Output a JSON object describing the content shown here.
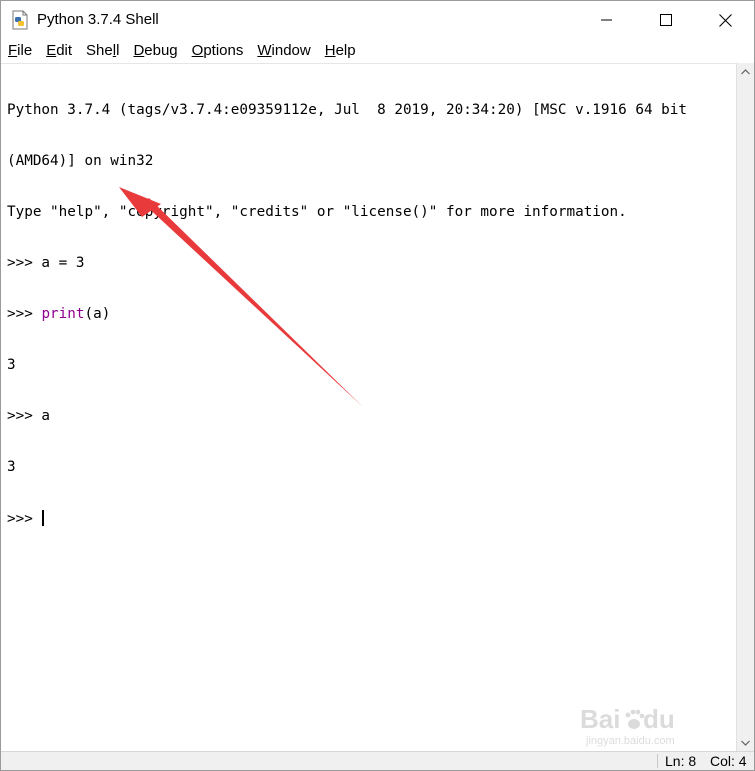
{
  "window": {
    "title": "Python 3.7.4 Shell",
    "controls": {
      "minimize_icon": "minimize-icon",
      "maximize_icon": "maximize-icon",
      "close_icon": "close-icon"
    }
  },
  "menu": {
    "items": [
      {
        "label": "File",
        "mnemonic": "F"
      },
      {
        "label": "Edit",
        "mnemonic": "E"
      },
      {
        "label": "Shell",
        "mnemonic": "l"
      },
      {
        "label": "Debug",
        "mnemonic": "D"
      },
      {
        "label": "Options",
        "mnemonic": "O"
      },
      {
        "label": "Window",
        "mnemonic": "W"
      },
      {
        "label": "Help",
        "mnemonic": "H"
      }
    ]
  },
  "shell": {
    "lines": [
      "Python 3.7.4 (tags/v3.7.4:e09359112e, Jul  8 2019, 20:34:20) [MSC v.1916 64 bit",
      "(AMD64)] on win32",
      "Type \"help\", \"copyright\", \"credits\" or \"license()\" for more information.",
      ">>> a = 3",
      ">>> ",
      "3",
      ">>> a",
      "3",
      ">>> "
    ],
    "print_keyword": "print",
    "print_args": "(a)",
    "keyword_color": "#900090"
  },
  "status": {
    "line": "Ln: 8",
    "column": "Col: 4"
  },
  "annotation": {
    "arrow_color": "#e8393b"
  },
  "watermark": {
    "brand": "Baidu",
    "sub": "jingyan.baidu.com"
  }
}
